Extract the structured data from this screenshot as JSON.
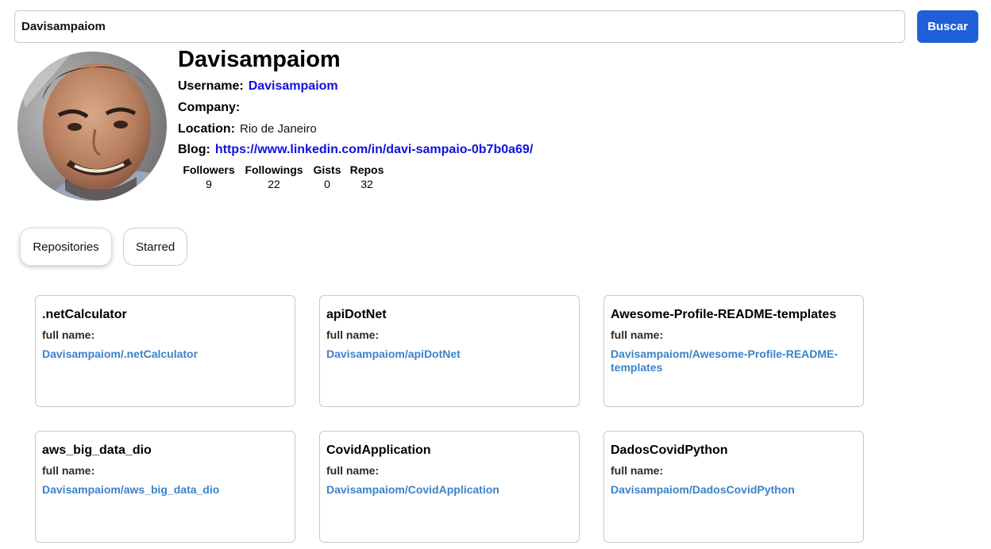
{
  "search": {
    "value": "Davisampaiom",
    "button_label": "Buscar"
  },
  "profile": {
    "name": "Davisampaiom",
    "username_label": "Username:",
    "username": "Davisampaiom",
    "company_label": "Company:",
    "company": "",
    "location_label": "Location:",
    "location": "Rio de Janeiro",
    "blog_label": "Blog:",
    "blog": "https://www.linkedin.com/in/davi-sampaio-0b7b0a69/"
  },
  "stats": [
    {
      "label": "Followers",
      "value": "9"
    },
    {
      "label": "Followings",
      "value": "22"
    },
    {
      "label": "Gists",
      "value": "0"
    },
    {
      "label": "Repos",
      "value": "32"
    }
  ],
  "tabs": {
    "repositories": "Repositories",
    "starred": "Starred"
  },
  "repos": [
    {
      "name": ".netCalculator",
      "full_name_label": "full name:",
      "full_name": "Davisampaiom/.netCalculator"
    },
    {
      "name": "apiDotNet",
      "full_name_label": "full name:",
      "full_name": "Davisampaiom/apiDotNet"
    },
    {
      "name": "Awesome-Profile-README-templates",
      "full_name_label": "full name:",
      "full_name": "Davisampaiom/Awesome-Profile-README-templates"
    },
    {
      "name": "aws_big_data_dio",
      "full_name_label": "full name:",
      "full_name": "Davisampaiom/aws_big_data_dio"
    },
    {
      "name": "CovidApplication",
      "full_name_label": "full name:",
      "full_name": "Davisampaiom/CovidApplication"
    },
    {
      "name": "DadosCovidPython",
      "full_name_label": "full name:",
      "full_name": "Davisampaiom/DadosCovidPython"
    }
  ],
  "colors": {
    "accent": "#1f5fd8",
    "link": "#1010e0",
    "repo_link": "#3b82c8"
  }
}
